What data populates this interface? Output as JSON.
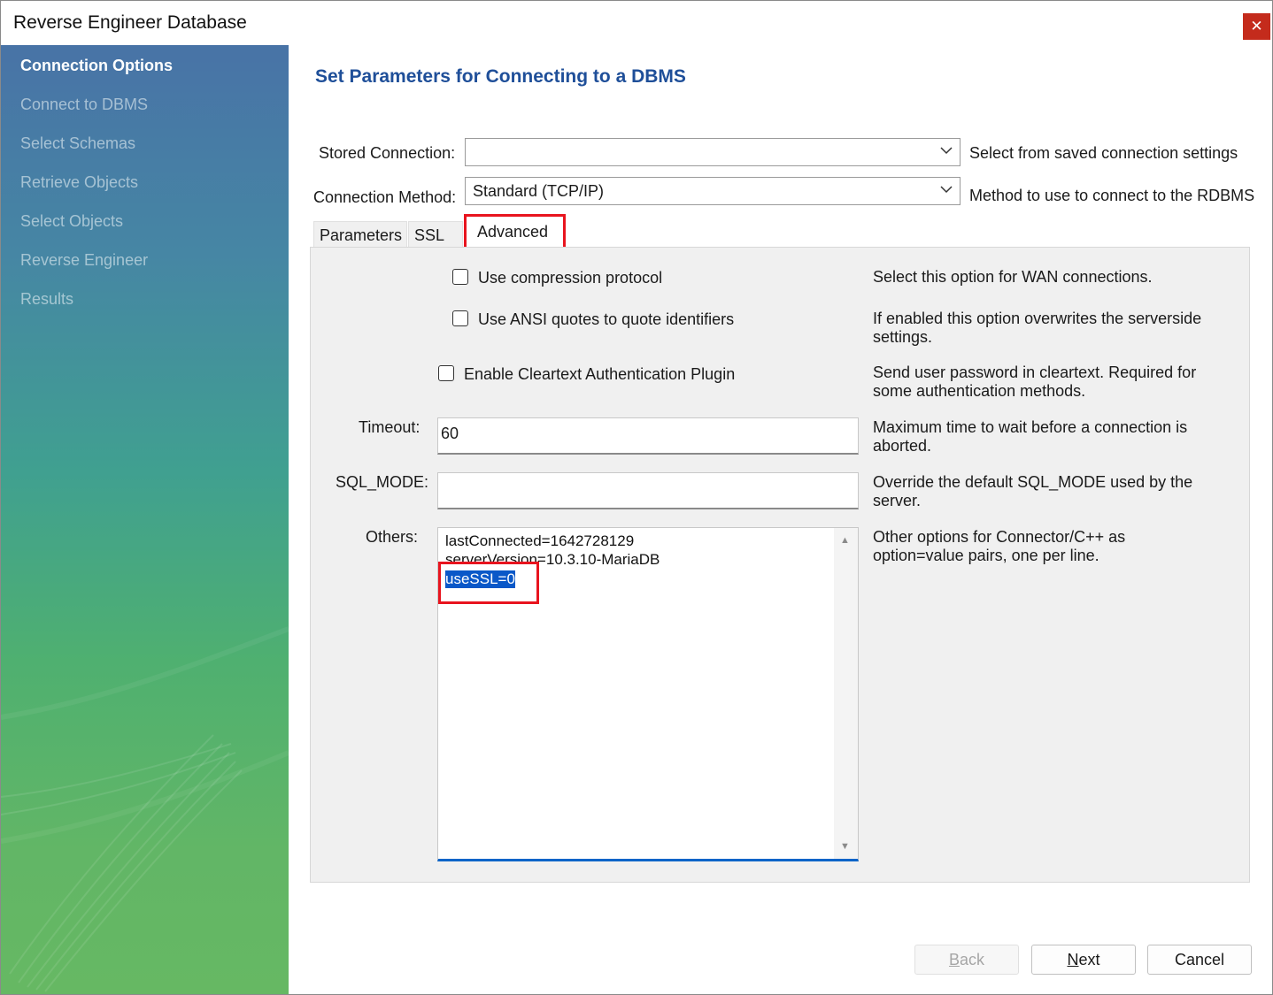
{
  "window": {
    "title": "Reverse Engineer Database",
    "close_glyph": "✕"
  },
  "sidebar": {
    "items": [
      {
        "label": "Connection Options",
        "active": true
      },
      {
        "label": "Connect to DBMS",
        "active": false
      },
      {
        "label": "Select Schemas",
        "active": false
      },
      {
        "label": "Retrieve Objects",
        "active": false
      },
      {
        "label": "Select Objects",
        "active": false
      },
      {
        "label": "Reverse Engineer",
        "active": false
      },
      {
        "label": "Results",
        "active": false
      }
    ]
  },
  "main": {
    "title": "Set Parameters for Connecting to a DBMS",
    "stored_connection": {
      "label": "Stored Connection:",
      "value": "",
      "hint": "Select from saved connection settings"
    },
    "connection_method": {
      "label": "Connection Method:",
      "value": "Standard (TCP/IP)",
      "hint": "Method to use to connect to the RDBMS"
    },
    "tabs": [
      {
        "label": "Parameters",
        "selected": false
      },
      {
        "label": "SSL",
        "selected": false
      },
      {
        "label": "Advanced",
        "selected": true
      }
    ],
    "advanced": {
      "compression": {
        "label": "Use compression protocol",
        "checked": false,
        "hint": "Select this option for WAN connections."
      },
      "ansi_quotes": {
        "label": "Use ANSI quotes to quote identifiers",
        "checked": false,
        "hint_line1": "If enabled this option overwrites the serverside",
        "hint_line2": "settings."
      },
      "cleartext": {
        "label": "Enable Cleartext Authentication Plugin",
        "checked": false,
        "hint_line1": "Send user password in cleartext. Required for",
        "hint_line2": "some authentication methods."
      },
      "timeout": {
        "label": "Timeout:",
        "value": "60",
        "hint_line1": "Maximum time to wait before a connection is",
        "hint_line2": "aborted."
      },
      "sql_mode": {
        "label": "SQL_MODE:",
        "value": "",
        "hint_line1": "Override the default SQL_MODE used by the",
        "hint_line2": "server."
      },
      "others": {
        "label": "Others:",
        "lines": [
          "lastConnected=1642728129",
          "serverVersion=10.3.10-MariaDB",
          "useSSL=0"
        ],
        "selected_line_index": 2,
        "hint_line1": "Other options for Connector/C++ as",
        "hint_line2": "option=value pairs, one per line."
      }
    }
  },
  "buttons": {
    "back": {
      "mnemonic": "B",
      "rest": "ack",
      "enabled": false
    },
    "next": {
      "mnemonic": "N",
      "rest": "ext",
      "enabled": true
    },
    "cancel": {
      "label": "Cancel",
      "enabled": true
    }
  },
  "scroll": {
    "up_glyph": "▲",
    "down_glyph": "▼"
  },
  "colors": {
    "title_blue": "#1f4f99",
    "highlight_red": "#e8141e",
    "selection_blue": "#0a58c8",
    "close_red": "#c42b1c"
  },
  "icons": {
    "close": "close-icon",
    "dropdown": "chevron-down-icon",
    "scroll_up": "scroll-up-icon",
    "scroll_down": "scroll-down-icon"
  }
}
